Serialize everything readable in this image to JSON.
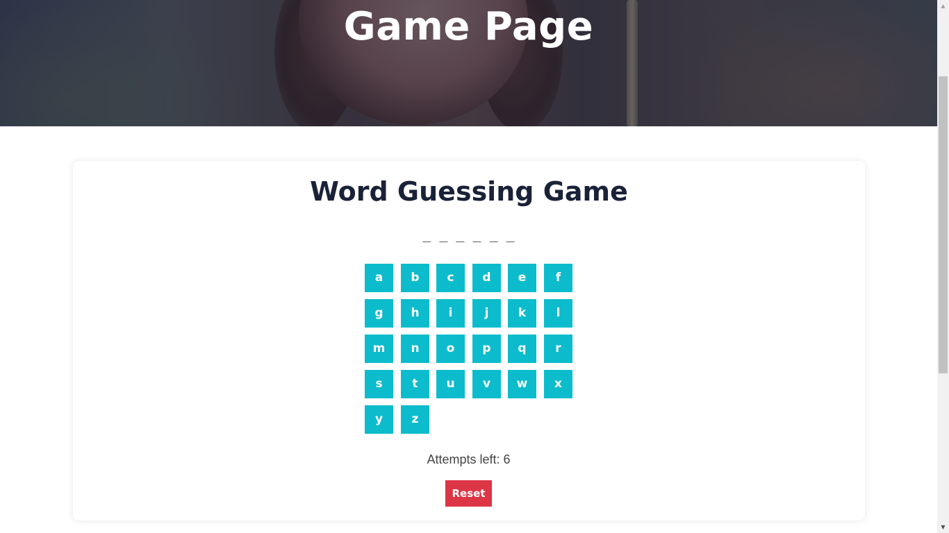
{
  "hero": {
    "title": "Game Page"
  },
  "game": {
    "title": "Word Guessing Game",
    "word_display": "_ _ _ _ _ _",
    "letters": [
      "a",
      "b",
      "c",
      "d",
      "e",
      "f",
      "g",
      "h",
      "i",
      "j",
      "k",
      "l",
      "m",
      "n",
      "o",
      "p",
      "q",
      "r",
      "s",
      "t",
      "u",
      "v",
      "w",
      "x",
      "y",
      "z"
    ],
    "attempts_label": "Attempts left: 6",
    "reset_label": "Reset"
  },
  "colors": {
    "letter_button": "#0cbccc",
    "reset_button": "#dc3545",
    "title_text": "#1a2238",
    "hero_overlay": "#161e3a"
  },
  "icons": {
    "scroll_up": "triangle-up-icon",
    "scroll_down": "triangle-down-icon"
  }
}
